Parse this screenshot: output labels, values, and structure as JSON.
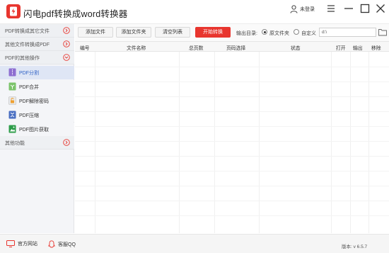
{
  "app": {
    "title": "闪电pdf转换成word转换器",
    "user_label": "未登录",
    "brand_color": "#e8352e"
  },
  "sidebar": {
    "categories": [
      {
        "label": "PDF转换成其它文件",
        "expanded": false
      },
      {
        "label": "其他文件转换成PDF",
        "expanded": false
      },
      {
        "label": "PDF的其他操作",
        "expanded": true
      },
      {
        "label": "其他功能",
        "expanded": false
      }
    ],
    "sub_items": [
      {
        "label": "PDF分割",
        "icon": "pdf-split-icon",
        "active": true
      },
      {
        "label": "PDF合并",
        "icon": "pdf-merge-icon",
        "active": false
      },
      {
        "label": "PDF解除密码",
        "icon": "pdf-unlock-icon",
        "active": false
      },
      {
        "label": "PDF压缩",
        "icon": "pdf-compress-icon",
        "active": false
      },
      {
        "label": "PDF图片获取",
        "icon": "pdf-image-extract-icon",
        "active": false
      }
    ]
  },
  "toolbar": {
    "add_file": "添加文件",
    "add_folder": "添加文件夹",
    "clear_list": "清空列表",
    "start_convert": "开始转换",
    "output_dir_label": "输出目录:",
    "radio_original": "原文件夹",
    "radio_custom": "自定义",
    "output_path": "d:\\",
    "selected_output": "原文件夹"
  },
  "table": {
    "columns": [
      "编号",
      "文件名称",
      "总页数",
      "页码选择",
      "状态",
      "打开",
      "输出",
      "移除"
    ],
    "rows": []
  },
  "footer": {
    "website": "官方网站",
    "qq": "客服QQ",
    "version": "版本: v 6.5.7"
  }
}
